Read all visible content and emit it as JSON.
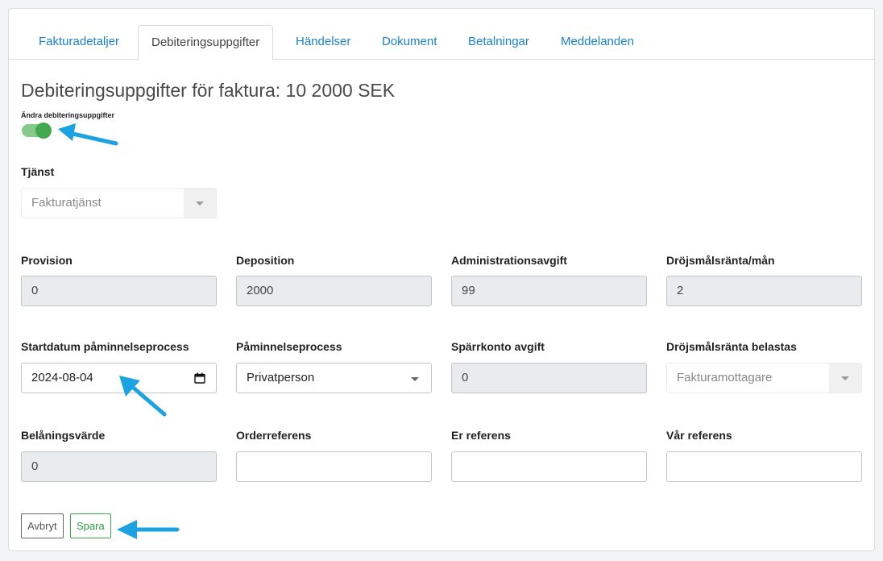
{
  "tabs": [
    {
      "label": "Fakturadetaljer"
    },
    {
      "label": "Debiteringsuppgifter"
    },
    {
      "label": "Händelser"
    },
    {
      "label": "Dokument"
    },
    {
      "label": "Betalningar"
    },
    {
      "label": "Meddelanden"
    }
  ],
  "active_tab": "Debiteringsuppgifter",
  "page_title": "Debiteringsuppgifter för faktura: 10 2000 SEK",
  "toggle": {
    "label": "Ändra debiteringsuppgifter",
    "on": true
  },
  "fields": {
    "tjanst": {
      "label": "Tjänst",
      "value": "Fakturatjänst"
    },
    "provision": {
      "label": "Provision",
      "value": "0"
    },
    "deposition": {
      "label": "Deposition",
      "value": "2000"
    },
    "administrationsavgift": {
      "label": "Administrationsavgift",
      "value": "99"
    },
    "drojsmalsranta_man": {
      "label": "Dröjsmålsränta/mån",
      "value": "2"
    },
    "startdatum": {
      "label": "Startdatum påminnelseprocess",
      "value": "2024-08-04"
    },
    "paminnelseprocess": {
      "label": "Påminnelseprocess",
      "value": "Privatperson"
    },
    "sparrkonto_avgift": {
      "label": "Spärrkonto avgift",
      "value": "0"
    },
    "drojsmalsranta_belastas": {
      "label": "Dröjsmålsränta belastas",
      "value": "Fakturamottagare"
    },
    "belaningsvarde": {
      "label": "Belåningsvärde",
      "value": "0"
    },
    "orderreferens": {
      "label": "Orderreferens",
      "value": ""
    },
    "er_referens": {
      "label": "Er referens",
      "value": ""
    },
    "var_referens": {
      "label": "Vår referens",
      "value": ""
    }
  },
  "buttons": {
    "cancel": "Avbryt",
    "save": "Spara"
  },
  "colors": {
    "link": "#1a7fd4",
    "toggle_on": "#43a94d",
    "save": "#2e9d3c",
    "annotation_arrow": "#1aa3e0"
  },
  "icons": {
    "calendar": "calendar-icon",
    "annotation": "arrow-annotation"
  }
}
